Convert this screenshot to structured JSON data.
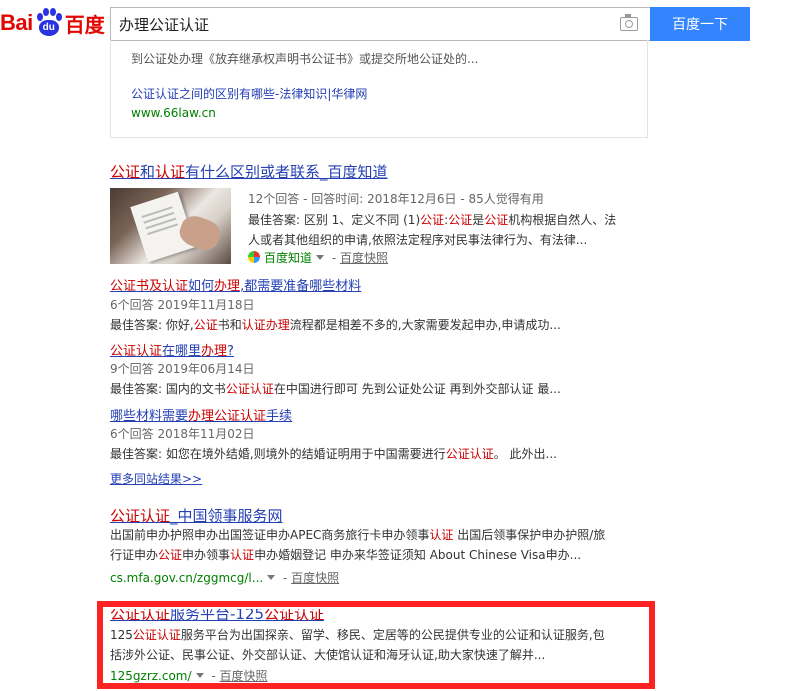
{
  "header": {
    "logo_bai": "Bai",
    "logo_du": "du",
    "logo_cn": "百度",
    "search_value": "办理公证认证",
    "search_button": "百度一下"
  },
  "card": {
    "snippet": "到公证处办理《放弃继承权声明书公证书》或提交所地公证处的...",
    "link": "公证认证之间的区别有哪些-法律知识|华律网",
    "site": "www.66law.cn"
  },
  "zhidao": {
    "title_parts": [
      "公证",
      "和",
      "认证",
      "有什么区别或者联系_百度知道"
    ],
    "meta": "12个回答 - 回答时间: 2018年12月6日 - 85人觉得有用",
    "best_line1_parts": [
      "最佳答案: 区别 1、定义不同 (1)",
      "公证",
      ":",
      "公证",
      "是",
      "公证",
      "机构根据自然人、法"
    ],
    "best_line2": "人或者其他组织的申请,依照法定程序对民事法律行为、有法律...",
    "source": "百度知道",
    "snapshot": "百度快照",
    "subs": [
      {
        "title_parts": [
          "公证书及",
          "认证",
          "如何",
          "办理",
          ",都需要准备哪些材料"
        ],
        "meta": "6个回答   2019年11月18日",
        "best_parts": [
          "最佳答案: 你好,",
          "公证",
          "书和",
          "认证",
          "办理",
          "流程都是相差不多的,大家需要发起申办,申请成功..."
        ]
      },
      {
        "title_parts": [
          "公证认证",
          "在哪里",
          "办理",
          "?"
        ],
        "meta": "9个回答   2019年06月14日",
        "best_parts": [
          "最佳答案: 国内的文书",
          "公证认证",
          "在中国进行即可 先到公证处公证 再到外交部认证 最..."
        ]
      },
      {
        "title_parts": [
          "哪些材料需要",
          "办理公证认证",
          "手续"
        ],
        "meta": "6个回答   2018年11月02日",
        "best_parts": [
          "最佳答案: 如您在境外结婚,则境外的结婚证明用于中国需要进行",
          "公证认证",
          "。 此外出..."
        ]
      }
    ],
    "more": "更多同站结果>>"
  },
  "mfa": {
    "title_parts": [
      "公证认证",
      "_中国领事服务网"
    ],
    "abs_line1_parts": [
      "出国前申办护照申办出国签证申办APEC商务旅行卡申办领事",
      "认证",
      " 出国后领事保护申办护照/旅"
    ],
    "abs_line2_parts": [
      "行证申办",
      "公证",
      "申办领事",
      "认证",
      "申办婚姻登记 申办来华签证须知 About Chinese Visa申办..."
    ],
    "url": "cs.mfa.gov.cn/zggmcg/l...",
    "snapshot": "百度快照"
  },
  "gzrz": {
    "title_parts": [
      "公证认证",
      "服务平台-125",
      "公证认证"
    ],
    "abs_line1_parts": [
      "125",
      "公证认证",
      "服务平台为出国探亲、留学、移民、定居等的公民提供专业的公证和认证服务,包"
    ],
    "abs_line2": "括涉外公证、民事公证、外交部认证、大使馆认证和海牙认证,助大家快速了解并...",
    "url": "125gzrz.com/",
    "snapshot": "百度快照"
  },
  "colors": {
    "link_blue": "#2440b3",
    "em_red": "#cc0000",
    "url_green": "#008000",
    "button_blue": "#3385ff",
    "highlight_red": "#ff2222"
  }
}
